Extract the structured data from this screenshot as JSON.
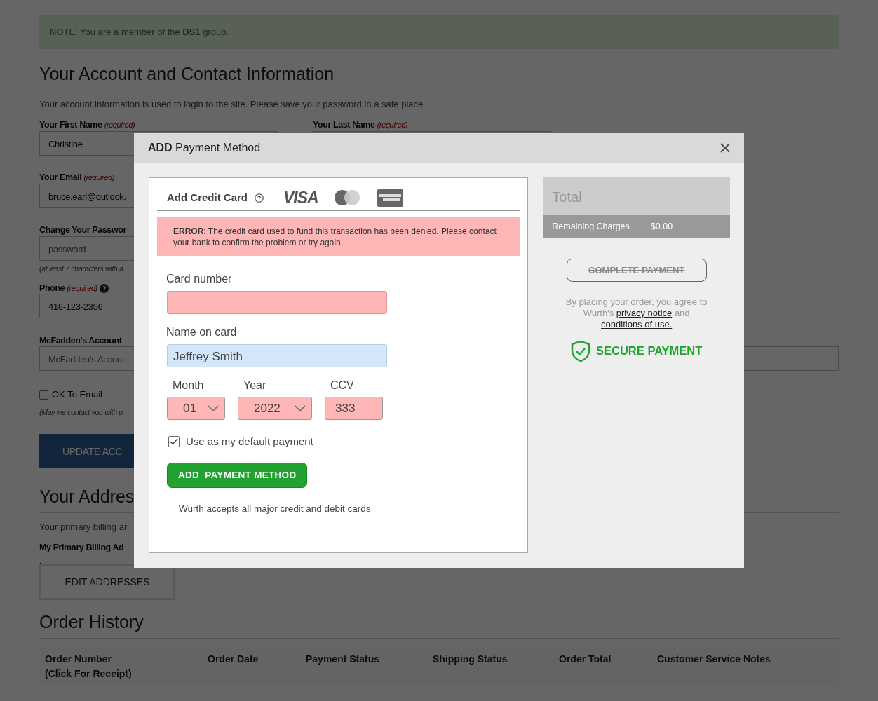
{
  "notice": {
    "text": "NOTE: You are a member of the **DS1** group."
  },
  "account": {
    "heading": "Your Account and Contact Information",
    "intro": "Your account information is used to login to the site. Please save your password in a safe place.",
    "rows": [
      {
        "left": {
          "label": "Your First Name",
          "required": "(required)",
          "value": "Christine"
        },
        "right": {
          "label": "Your Last Name",
          "required": "(required)"
        }
      },
      {
        "left": {
          "label": "Your Email",
          "required": "(required)",
          "value": "bruce.earl@outlook."
        }
      },
      {
        "left": {
          "label": "Change Your Passwor",
          "placeholder": "password",
          "hint": "(at least 7 characters with a"
        }
      },
      {
        "left": {
          "label": "Phone",
          "required": "(required)",
          "help": true,
          "value": "416-123-2356"
        }
      },
      {
        "left": {
          "label": "McFadden's Account",
          "placeholder": "McFadden's Accoun"
        },
        "right": {}
      }
    ],
    "opt_in": {
      "label": "OK To Email",
      "checked": false,
      "hint": "(May we contact you with p"
    },
    "button": "UPDATE ACC"
  },
  "addresses": {
    "heading": "Your Addres",
    "intro": "Your primary billing ar",
    "label": "My Primary Billing Ad",
    "address": ",",
    "button": "EDIT ADDRESSES"
  },
  "orders": {
    "heading": "Order History",
    "columns": [
      "Order Number\n(Click For Receipt)",
      "Order Date",
      "Payment Status",
      "Shipping Status",
      "Order Total",
      "Customer Service Notes"
    ]
  },
  "modal": {
    "title": "**ADD** Payment Method",
    "card": {
      "heading": "Add Credit Card",
      "logo_text": "VISA",
      "error": "**ERROR**:  The credit card used to fund this transaction has been denied. Please contact your bank to confirm the problem or try again.",
      "fields": [
        {
          "label": "Card number",
          "invalid": true
        },
        {
          "label": "Name on card",
          "value": "Jeffrey Smith",
          "invalid": false
        }
      ],
      "small_fields": [
        {
          "kind": "select",
          "label": "Month",
          "value": "01",
          "invalid": true
        },
        {
          "kind": "select",
          "label": "Year",
          "value": "2022",
          "invalid": true
        },
        {
          "kind": "text",
          "label": "CCV",
          "value": "333",
          "invalid": true
        }
      ],
      "default_payment": {
        "label": "Use as my default payment",
        "checked": true
      },
      "submit": "ADD  PAYMENT METHOD",
      "note": "Wurth accepts all major credit and debit cards"
    },
    "summary": {
      "title": "Total",
      "label": "Remaining Charges",
      "amount": "$0.00",
      "complete_button": {
        "label": "COMPLETE PAYMENT",
        "disabled": true
      },
      "agreement": [
        {
          "kind": "text",
          "text": "By placing your order, you agree to Wurth's "
        },
        {
          "kind": "link",
          "text": "privacy notice"
        },
        {
          "kind": "text",
          "text": " and "
        },
        {
          "kind": "link",
          "text": "conditions of use."
        }
      ],
      "secure": "SECURE PAYMENT"
    }
  }
}
